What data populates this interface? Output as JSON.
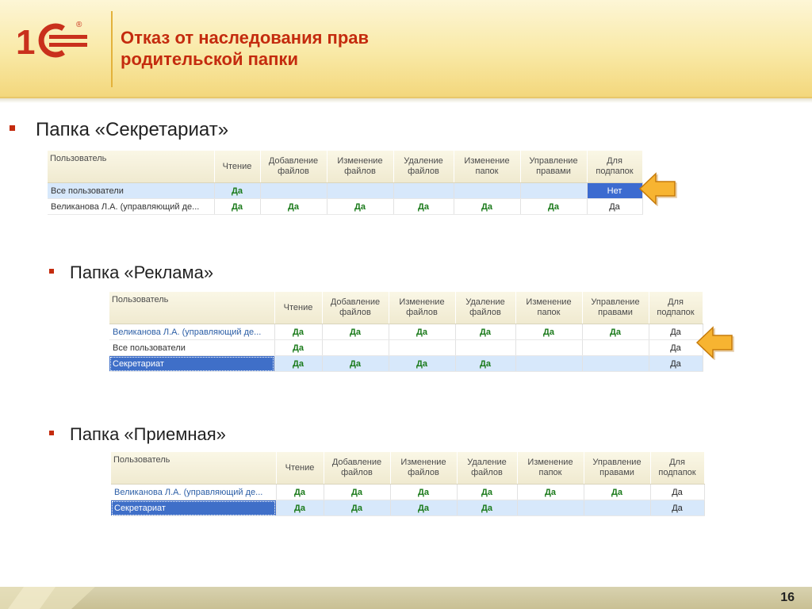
{
  "header": {
    "title_line1": "Отказ от наследования прав",
    "title_line2": "родительской папки",
    "logo_text": "1С",
    "logo_reg": "®"
  },
  "columns": [
    "Пользователь",
    "Чтение",
    "Добавление файлов",
    "Изменение файлов",
    "Удаление файлов",
    "Изменение папок",
    "Управление правами",
    "Для подпапок"
  ],
  "sections": [
    {
      "label": "Папка «Секретариат»",
      "rows": [
        {
          "user": "Все пользователи",
          "cells": [
            "Да",
            "",
            "",
            "",
            "",
            "",
            "Нет"
          ]
        },
        {
          "user": "Великанова Л.А. (управляющий де...",
          "cells": [
            "Да",
            "Да",
            "Да",
            "Да",
            "Да",
            "Да",
            "Да"
          ]
        }
      ]
    },
    {
      "label": "Папка «Реклама»",
      "rows": [
        {
          "user": "Великанова Л.А. (управляющий де...",
          "cells": [
            "Да",
            "Да",
            "Да",
            "Да",
            "Да",
            "Да",
            "Да"
          ]
        },
        {
          "user": "Все пользователи",
          "cells": [
            "Да",
            "",
            "",
            "",
            "",
            "",
            "Да"
          ]
        },
        {
          "user": "Секретариат",
          "cells": [
            "Да",
            "Да",
            "Да",
            "Да",
            "",
            "",
            "Да"
          ]
        }
      ]
    },
    {
      "label": "Папка «Приемная»",
      "rows": [
        {
          "user": "Великанова Л.А. (управляющий де...",
          "cells": [
            "Да",
            "Да",
            "Да",
            "Да",
            "Да",
            "Да",
            "Да"
          ]
        },
        {
          "user": "Секретариат",
          "cells": [
            "Да",
            "Да",
            "Да",
            "Да",
            "",
            "",
            "Да"
          ]
        }
      ]
    }
  ],
  "footer": {
    "page_number": "16"
  },
  "colors": {
    "accent": "#c42b0e",
    "yes_green": "#1a7a1a",
    "selection_blue": "#3f6fc8",
    "row_light": "#d7e8fb",
    "arrow_orange": "#f5a623"
  }
}
